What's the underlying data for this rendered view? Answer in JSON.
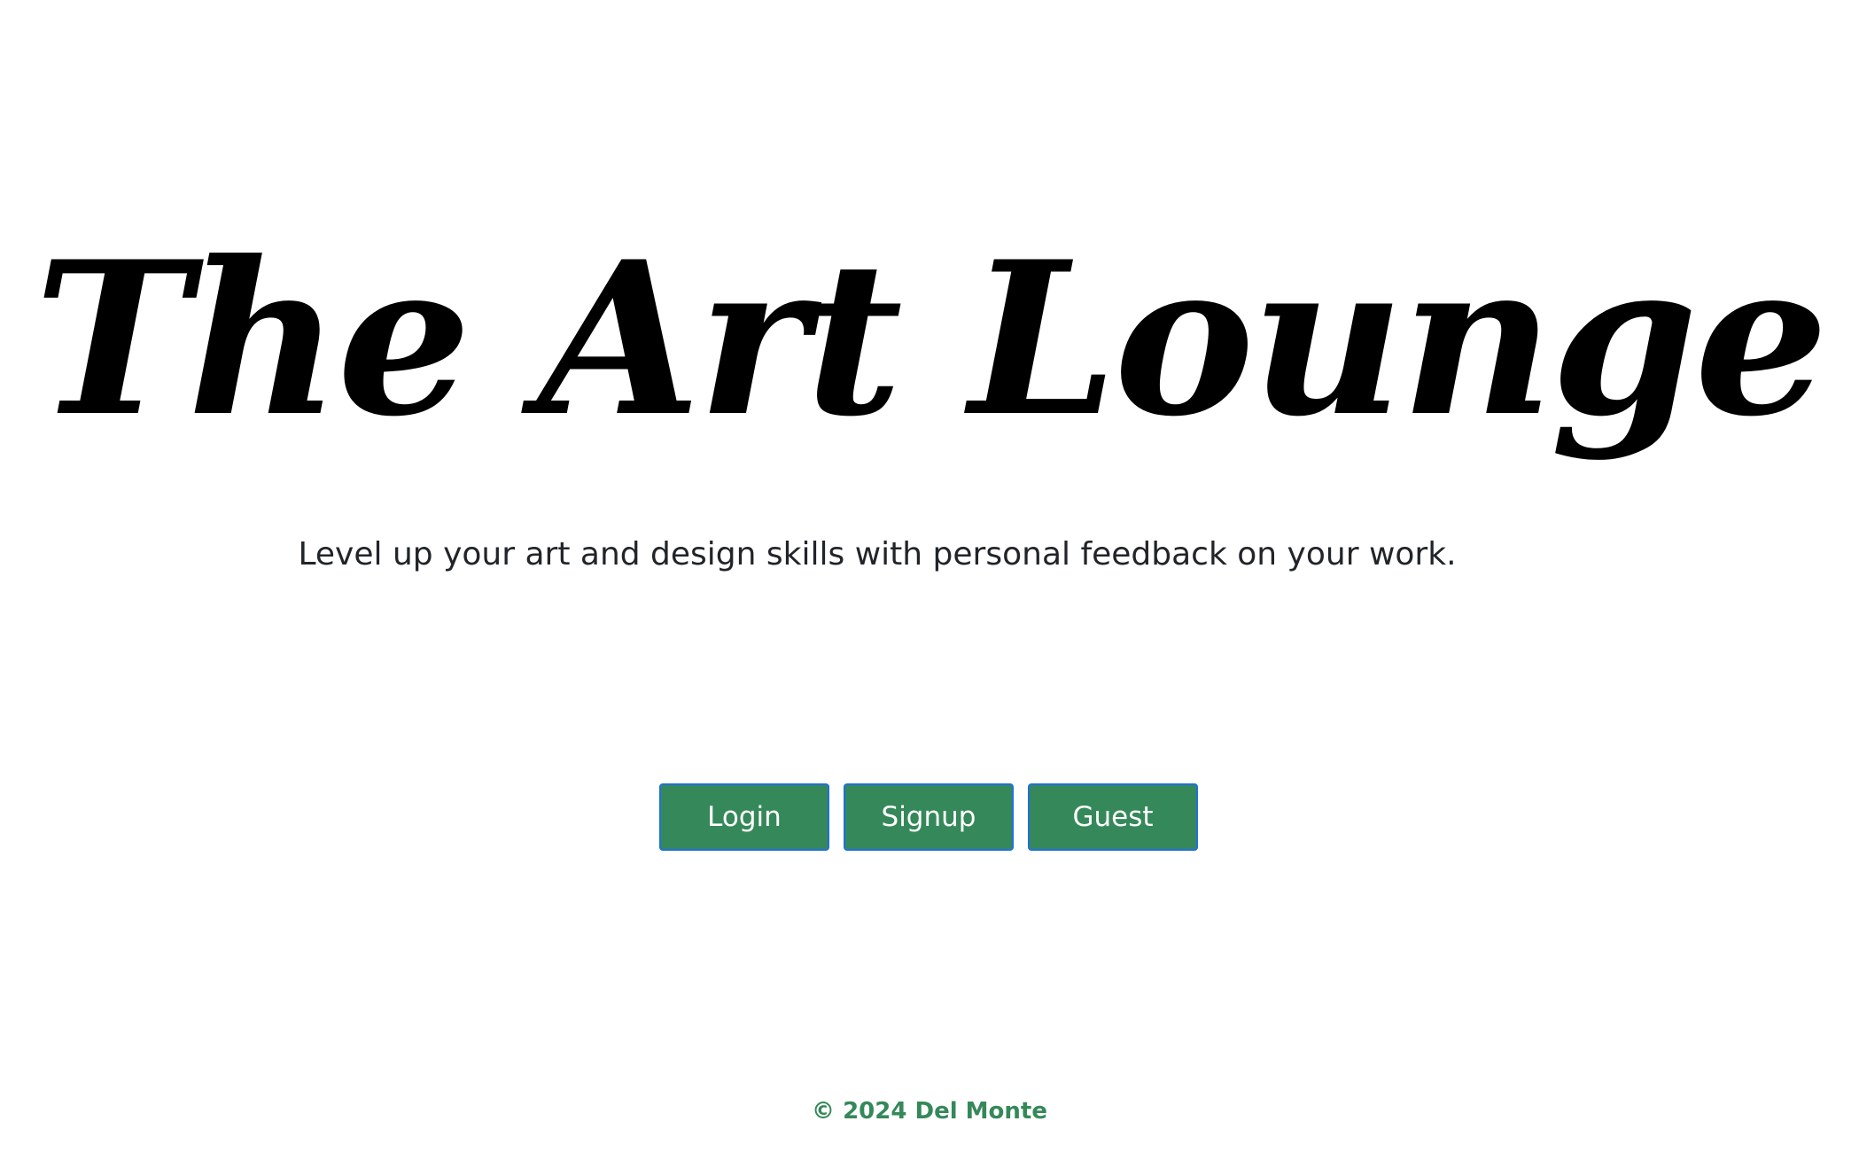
{
  "hero": {
    "title": "The Art Lounge",
    "tagline": "Level up your art and design skills with personal feedback on your work."
  },
  "actions": {
    "login_label": "Login",
    "signup_label": "Signup",
    "guest_label": "Guest"
  },
  "footer": {
    "copyright": "© 2024 Del Monte"
  },
  "colors": {
    "button_bg": "#358859",
    "button_border": "#1f6fe0",
    "footer_text": "#358859",
    "tagline_text": "#212529"
  }
}
